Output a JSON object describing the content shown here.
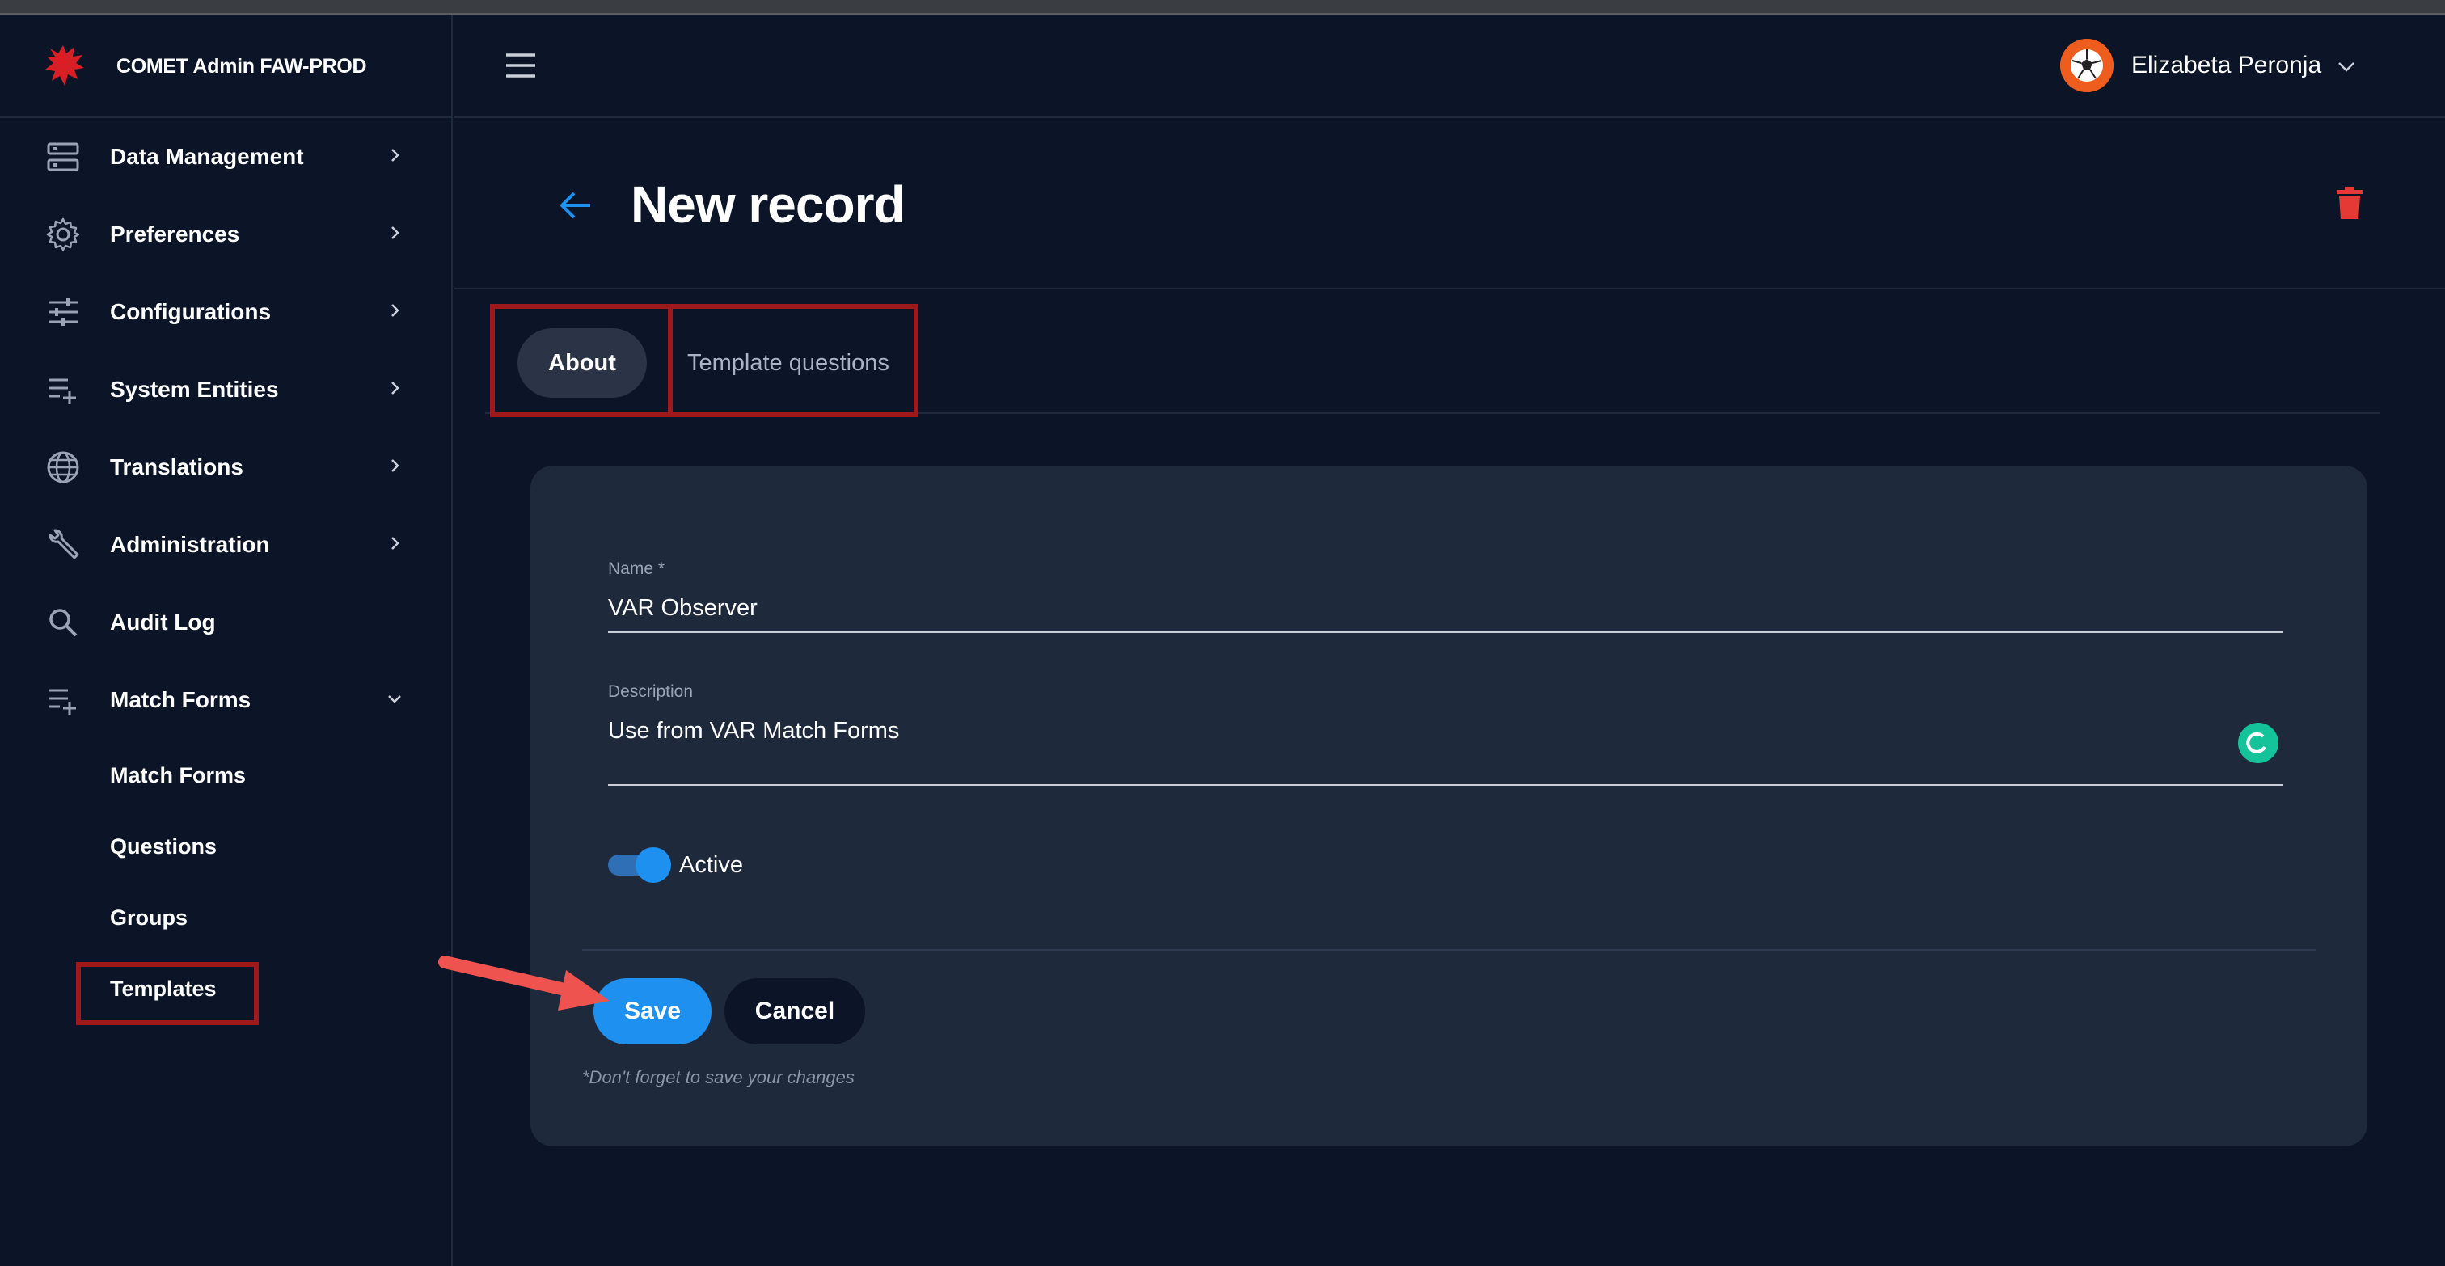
{
  "app": {
    "title": "COMET Admin FAW-PROD"
  },
  "sidebar": {
    "items": [
      {
        "label": "Data Management",
        "icon": "database-icon"
      },
      {
        "label": "Preferences",
        "icon": "gear-icon"
      },
      {
        "label": "Configurations",
        "icon": "sliders-icon"
      },
      {
        "label": "System Entities",
        "icon": "playlist-add-icon"
      },
      {
        "label": "Translations",
        "icon": "globe-icon"
      },
      {
        "label": "Administration",
        "icon": "wrench-icon"
      },
      {
        "label": "Audit Log",
        "icon": "search-icon"
      },
      {
        "label": "Match Forms",
        "icon": "playlist-add-icon"
      }
    ],
    "match_forms_children": [
      {
        "label": "Match Forms"
      },
      {
        "label": "Questions"
      },
      {
        "label": "Groups"
      },
      {
        "label": "Templates"
      }
    ]
  },
  "header": {
    "user_name": "Elizabeta Peronja"
  },
  "page": {
    "title": "New record"
  },
  "tabs": [
    {
      "label": "About"
    },
    {
      "label": "Template questions"
    }
  ],
  "form": {
    "name_label": "Name *",
    "name_value": "VAR Observer",
    "description_label": "Description",
    "description_value": "Use from VAR Match Forms",
    "active_label": "Active",
    "active": true,
    "save_label": "Save",
    "cancel_label": "Cancel",
    "hint": "*Don't forget to save your changes"
  },
  "colors": {
    "accent": "#1e90f0",
    "background": "#0c1527",
    "card": "#1e293b",
    "danger": "#e53935",
    "highlight_box": "#9e1a1a",
    "annotation_arrow": "#ef5350"
  }
}
